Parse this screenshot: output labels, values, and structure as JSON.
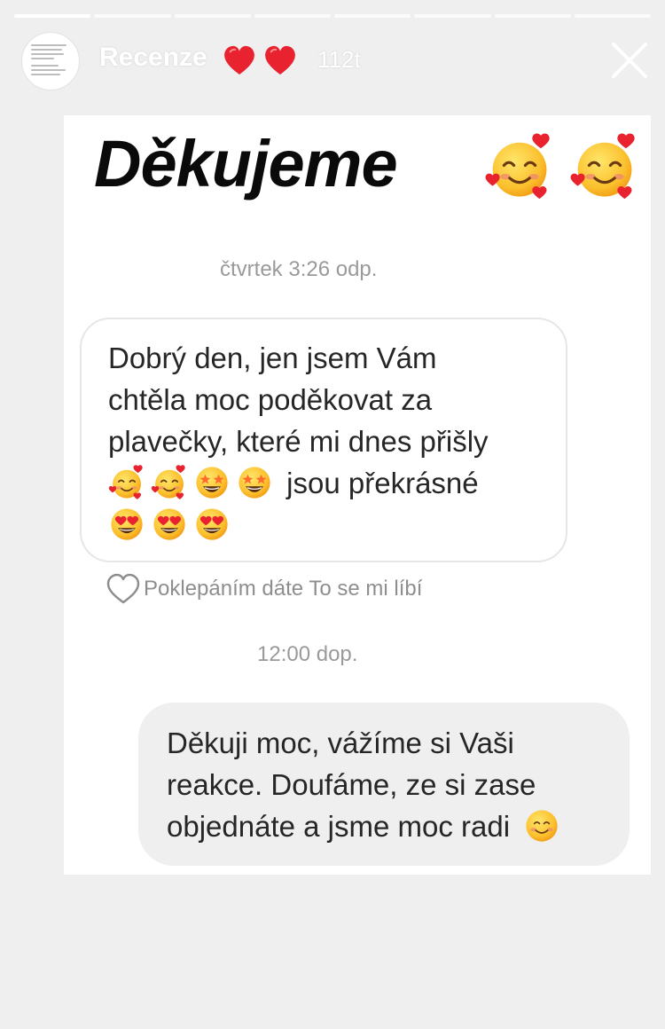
{
  "story": {
    "title": "Recenze",
    "hearts": [
      "heart-icon",
      "heart-icon"
    ],
    "time_ago": "112t",
    "progress_segments": 8,
    "progress_current_index": 0
  },
  "content": {
    "headline": "Děkujeme",
    "headline_emojis": [
      "smiling-face-with-hearts",
      "smiling-face-with-hearts"
    ],
    "timestamp_1": "čtvrtek 3:26 odp.",
    "incoming_message": {
      "line1": "Dobrý den, jen jsem Vám",
      "line2": "chtěla moc poděkovat za",
      "line3": "plavečky, které mi dnes přišly",
      "line4_text": "jsou překrásné",
      "line4_emojis": [
        "smiling-face-with-hearts",
        "smiling-face-with-hearts",
        "star-struck",
        "star-struck"
      ],
      "line5_emojis": [
        "heart-eyes",
        "heart-eyes",
        "heart-eyes"
      ]
    },
    "like_hint": "Poklepáním dáte To se mi líbí",
    "timestamp_2": "12:00 dop.",
    "outgoing_message": {
      "line1": "Děkuji moc, vážíme si Vaši",
      "line2": "reakce. Doufáme, ze si zase",
      "line3": "objednáte a jsme moc radi",
      "line3_emoji": "smiling-face"
    }
  },
  "colors": {
    "story_background": "#efefef",
    "card_background": "#ffffff",
    "heart_red": "#e8232f",
    "text_primary": "#262626",
    "text_secondary": "#9a9a9a",
    "outgoing_bubble": "#efefef"
  }
}
